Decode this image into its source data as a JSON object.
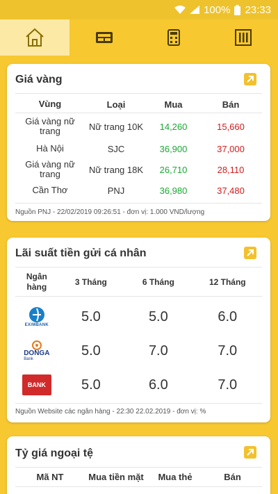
{
  "status_bar": {
    "battery": "100%",
    "time": "23:33"
  },
  "nav": {
    "tabs": [
      "home-icon",
      "ticket-icon",
      "calculator-icon",
      "archive-icon"
    ],
    "active_index": 0
  },
  "gold": {
    "title": "Giá vàng",
    "headers": [
      "Vùng",
      "Loại",
      "Mua",
      "Bán"
    ],
    "rows": [
      {
        "region": "Giá vàng nữ trang",
        "type": "Nữ trang 10K",
        "buy": "14,260",
        "sell": "15,660"
      },
      {
        "region": "Hà Nội",
        "type": "SJC",
        "buy": "36,900",
        "sell": "37,000"
      },
      {
        "region": "Giá vàng nữ trang",
        "type": "Nữ trang 18K",
        "buy": "26,710",
        "sell": "28,110"
      },
      {
        "region": "Cần Thơ",
        "type": "PNJ",
        "buy": "36,980",
        "sell": "37,480"
      }
    ],
    "source": "Nguồn PNJ - 22/02/2019 09:26:51 - đơn vị: 1.000 VND/lượng"
  },
  "interest": {
    "title": "Lãi suất tiền gửi cá nhân",
    "headers": [
      "Ngân hàng",
      "3 Tháng",
      "6 Tháng",
      "12 Tháng"
    ],
    "rows": [
      {
        "bank": "EXIMBANK",
        "m3": "5.0",
        "m6": "5.0",
        "m12": "6.0"
      },
      {
        "bank": "DONGA",
        "bank_sub": "Bank",
        "m3": "5.0",
        "m6": "7.0",
        "m12": "7.0"
      },
      {
        "bank": "BANK",
        "m3": "5.0",
        "m6": "6.0",
        "m12": "7.0"
      }
    ],
    "source": "Nguồn Website các ngân hàng - 22:30 22.02.2019 - đơn vị: %"
  },
  "fx": {
    "title": "Tỷ giá ngoại tệ",
    "headers": [
      "Mã NT",
      "Mua tiền mặt",
      "Mua thẻ",
      "Bán"
    ]
  },
  "colors": {
    "accent": "#f7c830",
    "buy": "#1aa834",
    "sell": "#d31d1d"
  }
}
